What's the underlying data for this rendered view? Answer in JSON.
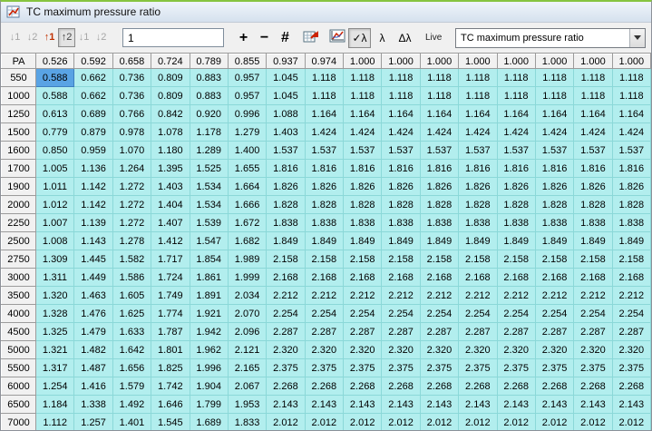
{
  "window": {
    "title": "TC maximum pressure ratio"
  },
  "toolbar": {
    "step_buttons": [
      {
        "label": "↓1",
        "state": "disabled"
      },
      {
        "label": "↓2",
        "state": "disabled"
      },
      {
        "label": "↑1",
        "state": "red"
      },
      {
        "label": "↑2",
        "state": "pressed"
      },
      {
        "label": "↓1",
        "state": "disabled"
      },
      {
        "label": "↓2",
        "state": "disabled"
      }
    ],
    "step_value": "1",
    "plus_label": "+",
    "minus_label": "−",
    "grid_label": "#",
    "icons": {
      "table_export": "table-red-arrow-icon",
      "graph": "graph-icon"
    },
    "lambda_check_label": "✓λ",
    "lambda_label": "λ",
    "lambda_delta_label": "Δλ",
    "live_label": "Live",
    "map_selector_value": "TC maximum pressure ratio"
  },
  "table": {
    "corner": "PA",
    "col_headers": [
      "0.526",
      "0.592",
      "0.658",
      "0.724",
      "0.789",
      "0.855",
      "0.937",
      "0.974",
      "1.000",
      "1.000",
      "1.000",
      "1.000",
      "1.000",
      "1.000",
      "1.000",
      "1.000"
    ],
    "row_headers": [
      "550",
      "1000",
      "1250",
      "1500",
      "1600",
      "1700",
      "1900",
      "2000",
      "2250",
      "2500",
      "2750",
      "3000",
      "3500",
      "4000",
      "4500",
      "5000",
      "5500",
      "6000",
      "6500",
      "7000"
    ],
    "selected": {
      "row": 0,
      "col": 0
    },
    "rows": [
      [
        "0.588",
        "0.662",
        "0.736",
        "0.809",
        "0.883",
        "0.957",
        "1.045",
        "1.118",
        "1.118",
        "1.118",
        "1.118",
        "1.118",
        "1.118",
        "1.118",
        "1.118",
        "1.118"
      ],
      [
        "0.588",
        "0.662",
        "0.736",
        "0.809",
        "0.883",
        "0.957",
        "1.045",
        "1.118",
        "1.118",
        "1.118",
        "1.118",
        "1.118",
        "1.118",
        "1.118",
        "1.118",
        "1.118"
      ],
      [
        "0.613",
        "0.689",
        "0.766",
        "0.842",
        "0.920",
        "0.996",
        "1.088",
        "1.164",
        "1.164",
        "1.164",
        "1.164",
        "1.164",
        "1.164",
        "1.164",
        "1.164",
        "1.164"
      ],
      [
        "0.779",
        "0.879",
        "0.978",
        "1.078",
        "1.178",
        "1.279",
        "1.403",
        "1.424",
        "1.424",
        "1.424",
        "1.424",
        "1.424",
        "1.424",
        "1.424",
        "1.424",
        "1.424"
      ],
      [
        "0.850",
        "0.959",
        "1.070",
        "1.180",
        "1.289",
        "1.400",
        "1.537",
        "1.537",
        "1.537",
        "1.537",
        "1.537",
        "1.537",
        "1.537",
        "1.537",
        "1.537",
        "1.537"
      ],
      [
        "1.005",
        "1.136",
        "1.264",
        "1.395",
        "1.525",
        "1.655",
        "1.816",
        "1.816",
        "1.816",
        "1.816",
        "1.816",
        "1.816",
        "1.816",
        "1.816",
        "1.816",
        "1.816"
      ],
      [
        "1.011",
        "1.142",
        "1.272",
        "1.403",
        "1.534",
        "1.664",
        "1.826",
        "1.826",
        "1.826",
        "1.826",
        "1.826",
        "1.826",
        "1.826",
        "1.826",
        "1.826",
        "1.826"
      ],
      [
        "1.012",
        "1.142",
        "1.272",
        "1.404",
        "1.534",
        "1.666",
        "1.828",
        "1.828",
        "1.828",
        "1.828",
        "1.828",
        "1.828",
        "1.828",
        "1.828",
        "1.828",
        "1.828"
      ],
      [
        "1.007",
        "1.139",
        "1.272",
        "1.407",
        "1.539",
        "1.672",
        "1.838",
        "1.838",
        "1.838",
        "1.838",
        "1.838",
        "1.838",
        "1.838",
        "1.838",
        "1.838",
        "1.838"
      ],
      [
        "1.008",
        "1.143",
        "1.278",
        "1.412",
        "1.547",
        "1.682",
        "1.849",
        "1.849",
        "1.849",
        "1.849",
        "1.849",
        "1.849",
        "1.849",
        "1.849",
        "1.849",
        "1.849"
      ],
      [
        "1.309",
        "1.445",
        "1.582",
        "1.717",
        "1.854",
        "1.989",
        "2.158",
        "2.158",
        "2.158",
        "2.158",
        "2.158",
        "2.158",
        "2.158",
        "2.158",
        "2.158",
        "2.158"
      ],
      [
        "1.311",
        "1.449",
        "1.586",
        "1.724",
        "1.861",
        "1.999",
        "2.168",
        "2.168",
        "2.168",
        "2.168",
        "2.168",
        "2.168",
        "2.168",
        "2.168",
        "2.168",
        "2.168"
      ],
      [
        "1.320",
        "1.463",
        "1.605",
        "1.749",
        "1.891",
        "2.034",
        "2.212",
        "2.212",
        "2.212",
        "2.212",
        "2.212",
        "2.212",
        "2.212",
        "2.212",
        "2.212",
        "2.212"
      ],
      [
        "1.328",
        "1.476",
        "1.625",
        "1.774",
        "1.921",
        "2.070",
        "2.254",
        "2.254",
        "2.254",
        "2.254",
        "2.254",
        "2.254",
        "2.254",
        "2.254",
        "2.254",
        "2.254"
      ],
      [
        "1.325",
        "1.479",
        "1.633",
        "1.787",
        "1.942",
        "2.096",
        "2.287",
        "2.287",
        "2.287",
        "2.287",
        "2.287",
        "2.287",
        "2.287",
        "2.287",
        "2.287",
        "2.287"
      ],
      [
        "1.321",
        "1.482",
        "1.642",
        "1.801",
        "1.962",
        "2.121",
        "2.320",
        "2.320",
        "2.320",
        "2.320",
        "2.320",
        "2.320",
        "2.320",
        "2.320",
        "2.320",
        "2.320"
      ],
      [
        "1.317",
        "1.487",
        "1.656",
        "1.825",
        "1.996",
        "2.165",
        "2.375",
        "2.375",
        "2.375",
        "2.375",
        "2.375",
        "2.375",
        "2.375",
        "2.375",
        "2.375",
        "2.375"
      ],
      [
        "1.254",
        "1.416",
        "1.579",
        "1.742",
        "1.904",
        "2.067",
        "2.268",
        "2.268",
        "2.268",
        "2.268",
        "2.268",
        "2.268",
        "2.268",
        "2.268",
        "2.268",
        "2.268"
      ],
      [
        "1.184",
        "1.338",
        "1.492",
        "1.646",
        "1.799",
        "1.953",
        "2.143",
        "2.143",
        "2.143",
        "2.143",
        "2.143",
        "2.143",
        "2.143",
        "2.143",
        "2.143",
        "2.143"
      ],
      [
        "1.112",
        "1.257",
        "1.401",
        "1.545",
        "1.689",
        "1.833",
        "2.012",
        "2.012",
        "2.012",
        "2.012",
        "2.012",
        "2.012",
        "2.012",
        "2.012",
        "2.012",
        "2.012"
      ]
    ]
  }
}
